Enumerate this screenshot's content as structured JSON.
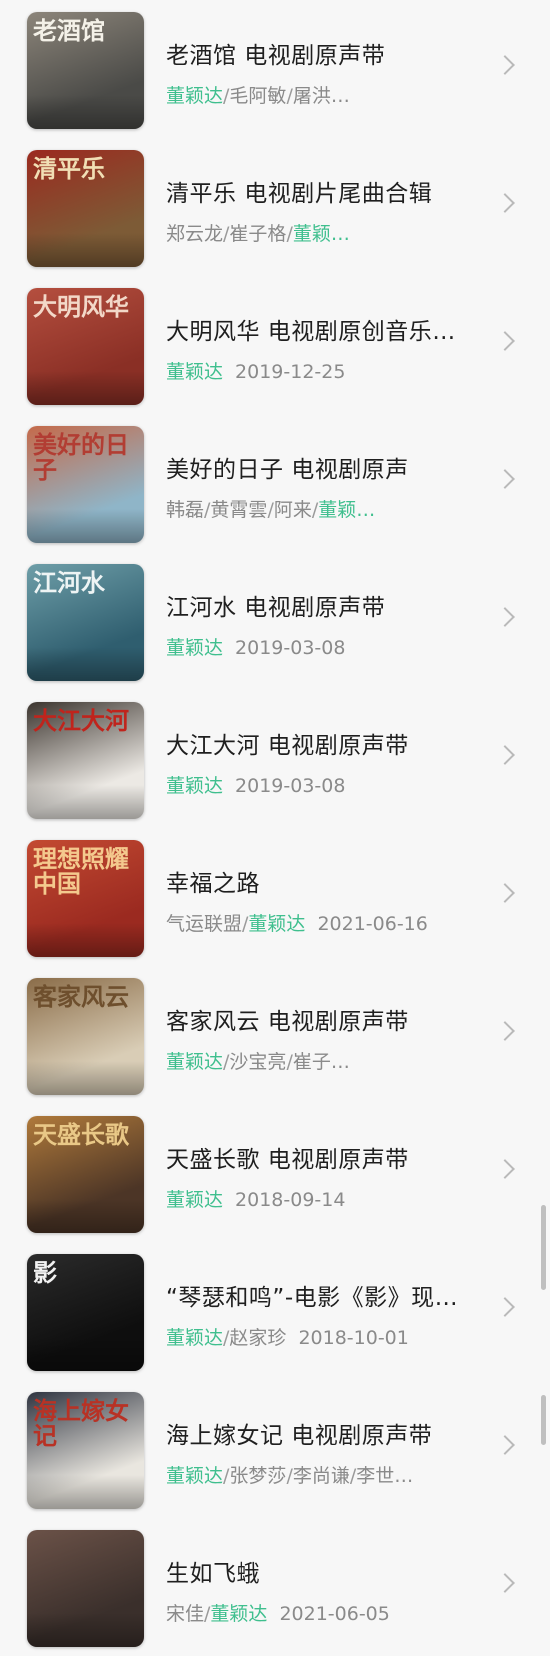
{
  "albums": [
    {
      "title": "老酒馆 电视剧原声带",
      "cover_icon": "album-cover-old-tavern",
      "cover_text": "老酒馆",
      "subtitle": [
        {
          "text": "董颖达",
          "hl": true
        },
        {
          "text": "/",
          "sep": true
        },
        {
          "text": "毛阿敏",
          "hl": false
        },
        {
          "text": "/",
          "sep": true
        },
        {
          "text": "屠洪…",
          "hl": false
        }
      ],
      "date": "",
      "colors": {
        "bg": "#4a4a47",
        "accent": "#8c857a",
        "text": "#f4f1e8"
      }
    },
    {
      "title": "清平乐 电视剧片尾曲合辑",
      "cover_icon": "album-cover-qing-ping-le",
      "cover_text": "清平乐",
      "subtitle": [
        {
          "text": "郑云龙",
          "hl": false
        },
        {
          "text": "/",
          "sep": true
        },
        {
          "text": "崔子格",
          "hl": false
        },
        {
          "text": "/",
          "sep": true
        },
        {
          "text": "董颖…",
          "hl": true
        }
      ],
      "date": "",
      "colors": {
        "bg": "#7d5b36",
        "accent": "#9b2a1f",
        "text": "#f1dfb5"
      }
    },
    {
      "title": "大明风华 电视剧原创音乐…",
      "cover_icon": "album-cover-da-ming-feng-hua",
      "cover_text": "大明风华",
      "subtitle": [
        {
          "text": "董颖达",
          "hl": true
        }
      ],
      "date": "2019-12-25",
      "colors": {
        "bg": "#8a2f25",
        "accent": "#b54f3f",
        "text": "#f2d8c8"
      }
    },
    {
      "title": "美好的日子 电视剧原声",
      "cover_icon": "album-cover-mei-hao-de-ri-zi",
      "cover_text": "美好的日子",
      "subtitle": [
        {
          "text": "韩磊",
          "hl": false
        },
        {
          "text": "/",
          "sep": true
        },
        {
          "text": "黄霄雲",
          "hl": false
        },
        {
          "text": "/",
          "sep": true
        },
        {
          "text": "阿来",
          "hl": false
        },
        {
          "text": "/",
          "sep": true
        },
        {
          "text": "董颖…",
          "hl": true
        }
      ],
      "date": "",
      "colors": {
        "bg": "#8fb5c8",
        "accent": "#c56a4a",
        "text": "#b23d33"
      }
    },
    {
      "title": "江河水 电视剧原声带",
      "cover_icon": "album-cover-jiang-he-shui",
      "cover_text": "江河水",
      "subtitle": [
        {
          "text": "董颖达",
          "hl": true
        }
      ],
      "date": "2019-03-08",
      "colors": {
        "bg": "#2f5e6f",
        "accent": "#6e9ea8",
        "text": "#eef4f4"
      }
    },
    {
      "title": "大江大河 电视剧原声带",
      "cover_icon": "album-cover-da-jiang-da-he",
      "cover_text": "大江大河",
      "subtitle": [
        {
          "text": "董颖达",
          "hl": true
        }
      ],
      "date": "2019-03-08",
      "colors": {
        "bg": "#ece9e4",
        "accent": "#3b342e",
        "text": "#c0241c"
      }
    },
    {
      "title": "幸福之路",
      "cover_icon": "album-cover-xing-fu-zhi-lu",
      "cover_text": "理想照耀中国",
      "subtitle": [
        {
          "text": "气运联盟",
          "hl": false
        },
        {
          "text": "/",
          "sep": true
        },
        {
          "text": "董颖达",
          "hl": true
        }
      ],
      "date": "2021-06-16",
      "colors": {
        "bg": "#9b2a20",
        "accent": "#c34a32",
        "text": "#f4c98e"
      }
    },
    {
      "title": "客家风云 电视剧原声带",
      "cover_icon": "album-cover-ke-jia-feng-yun",
      "cover_text": "客家风云",
      "subtitle": [
        {
          "text": "董颖达",
          "hl": true
        },
        {
          "text": "/",
          "sep": true
        },
        {
          "text": "沙宝亮",
          "hl": false
        },
        {
          "text": "/",
          "sep": true
        },
        {
          "text": "崔子…",
          "hl": false
        }
      ],
      "date": "",
      "colors": {
        "bg": "#d9cdb6",
        "accent": "#8a6c48",
        "text": "#6e4f2d"
      }
    },
    {
      "title": "天盛长歌 电视剧原声带",
      "cover_icon": "album-cover-tian-sheng-chang-ge",
      "cover_text": "天盛长歌",
      "subtitle": [
        {
          "text": "董颖达",
          "hl": true
        }
      ],
      "date": "2018-09-14",
      "colors": {
        "bg": "#4c3526",
        "accent": "#b07a3b",
        "text": "#e9c887"
      }
    },
    {
      "title": "“琴瑟和鸣”-电影《影》现…",
      "cover_icon": "album-cover-ying",
      "cover_text": "影",
      "subtitle": [
        {
          "text": "董颖达",
          "hl": true
        },
        {
          "text": "/",
          "sep": true
        },
        {
          "text": "赵家珍",
          "hl": false
        }
      ],
      "date": "2018-10-01",
      "colors": {
        "bg": "#0e0e0e",
        "accent": "#2b2b2b",
        "text": "#f2f2f2"
      }
    },
    {
      "title": "海上嫁女记 电视剧原声带",
      "cover_icon": "album-cover-hai-shang-jia-nv-ji",
      "cover_text": "海上嫁女记",
      "subtitle": [
        {
          "text": "董颖达",
          "hl": true
        },
        {
          "text": "/",
          "sep": true
        },
        {
          "text": "张梦莎",
          "hl": false
        },
        {
          "text": "/",
          "sep": true
        },
        {
          "text": "李尚谦",
          "hl": false
        },
        {
          "text": "/",
          "sep": true
        },
        {
          "text": "李世…",
          "hl": false
        }
      ],
      "date": "",
      "colors": {
        "bg": "#e9e6df",
        "accent": "#2f3440",
        "text": "#b83225"
      }
    },
    {
      "title": "生如飞蛾",
      "cover_icon": "album-cover-sheng-ru-fei-e",
      "cover_text": "",
      "subtitle": [
        {
          "text": "宋佳",
          "hl": false
        },
        {
          "text": "/",
          "sep": true
        },
        {
          "text": "董颖达",
          "hl": true
        }
      ],
      "date": "2021-06-05",
      "colors": {
        "bg": "#3a2f2b",
        "accent": "#6b5248",
        "text": "#e8d9cf"
      }
    }
  ]
}
